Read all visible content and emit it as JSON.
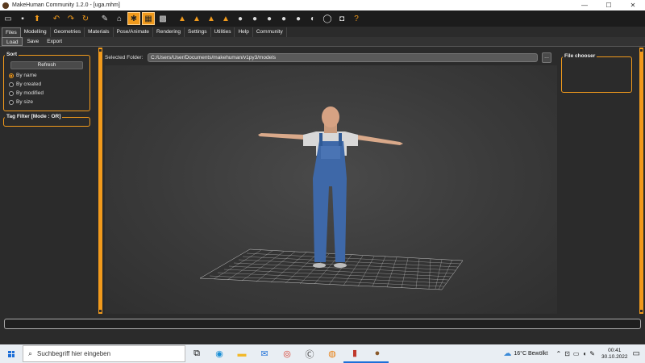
{
  "window": {
    "title": "MakeHuman Community 1.2.0 - [uga.mhm]",
    "minimize": "—",
    "maximize": "☐",
    "close": "✕"
  },
  "main_tabs": [
    "Files",
    "Modelling",
    "Geometries",
    "Materials",
    "Pose/Animate",
    "Rendering",
    "Settings",
    "Utilities",
    "Help",
    "Community"
  ],
  "sub_tabs": [
    "Load",
    "Save",
    "Export"
  ],
  "sort": {
    "title": "Sort",
    "refresh_label": "Refresh",
    "options": [
      "By name",
      "By created",
      "By modified",
      "By size"
    ],
    "selected": "By name"
  },
  "tag_filter": {
    "title": "Tag Filter [Mode : OR]"
  },
  "folder": {
    "label": "Selected Folder:",
    "path": "C:/Users/User/Documents/makehuman/v1py3/models",
    "browse_label": "..."
  },
  "file_chooser": {
    "title": "File chooser"
  },
  "colors": {
    "accent": "#f19a1c",
    "viewport": "#3a3a3a",
    "taskbar": "#e9eef3"
  },
  "taskbar": {
    "search_placeholder": "Suchbegriff hier eingeben",
    "apps": [
      "task-view-icon",
      "edge-icon",
      "file-explorer-icon",
      "mail-icon",
      "chrome-icon",
      "app-c-icon",
      "blender-icon",
      "makehuman-icon",
      "makehuman-community-icon"
    ],
    "weather": "16°C  Bewölkt",
    "time": "00:41",
    "date": "30.10.2022"
  }
}
